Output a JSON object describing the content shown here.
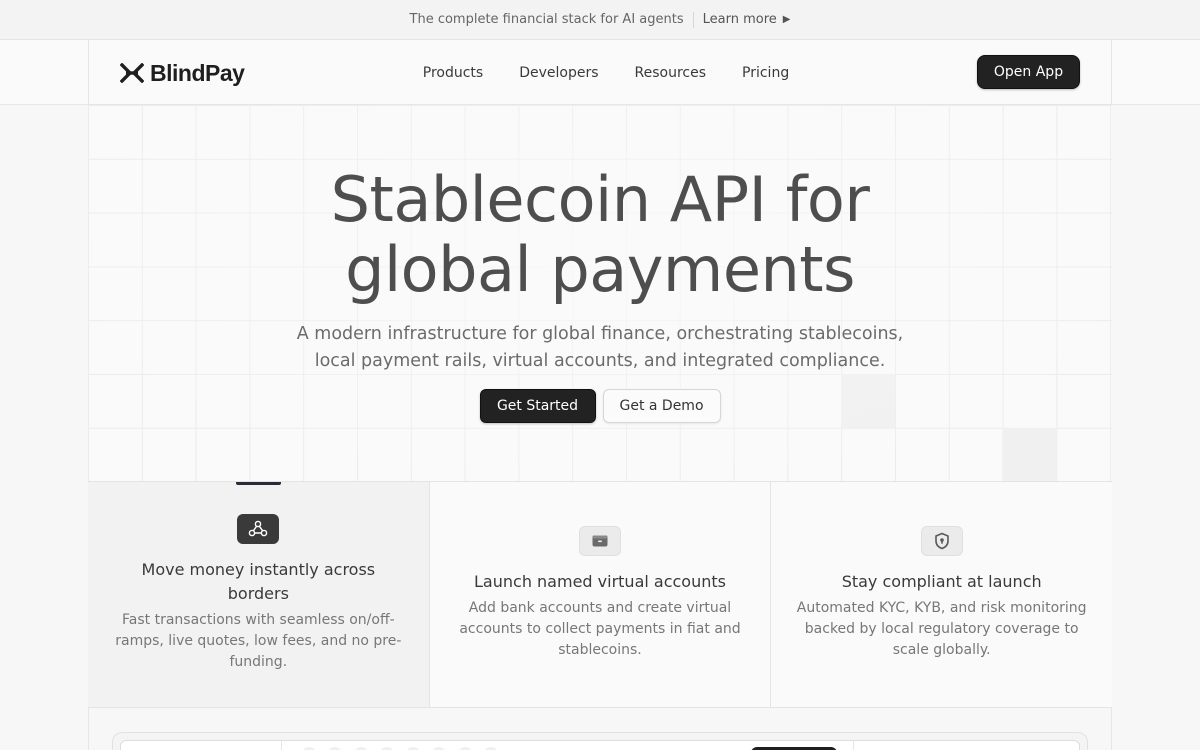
{
  "announcement": {
    "text": "The complete financial stack for AI agents",
    "link_label": "Learn more"
  },
  "header": {
    "logo_text": "BlindPay",
    "nav": [
      "Products",
      "Developers",
      "Resources",
      "Pricing"
    ],
    "cta_label": "Open App"
  },
  "hero": {
    "title_line1": "Stablecoin API for",
    "title_line2": "global payments",
    "subtitle_line1": "A modern infrastructure for global finance, orchestrating stablecoins,",
    "subtitle_line2": "local payment rails, virtual accounts, and integrated compliance.",
    "primary_label": "Get Started",
    "secondary_label": "Get a Demo"
  },
  "features": [
    {
      "icon": "network-icon",
      "title": "Move money instantly across borders",
      "description": "Fast transactions with seamless on/off-ramps, live quotes, low fees, and no pre-funding.",
      "active": true
    },
    {
      "icon": "wallet-icon",
      "title": "Launch named virtual accounts",
      "description": "Add bank accounts and create virtual accounts to collect payments in fiat and stablecoins.",
      "active": false
    },
    {
      "icon": "shield-icon",
      "title": "Stay compliant at launch",
      "description": "Automated KYC, KYB, and risk monitoring backed by local regulatory coverage to scale globally.",
      "active": false
    }
  ],
  "colors": {
    "primary_button": "#222222",
    "background": "#fafafa",
    "text_muted": "#6b6b6b"
  }
}
